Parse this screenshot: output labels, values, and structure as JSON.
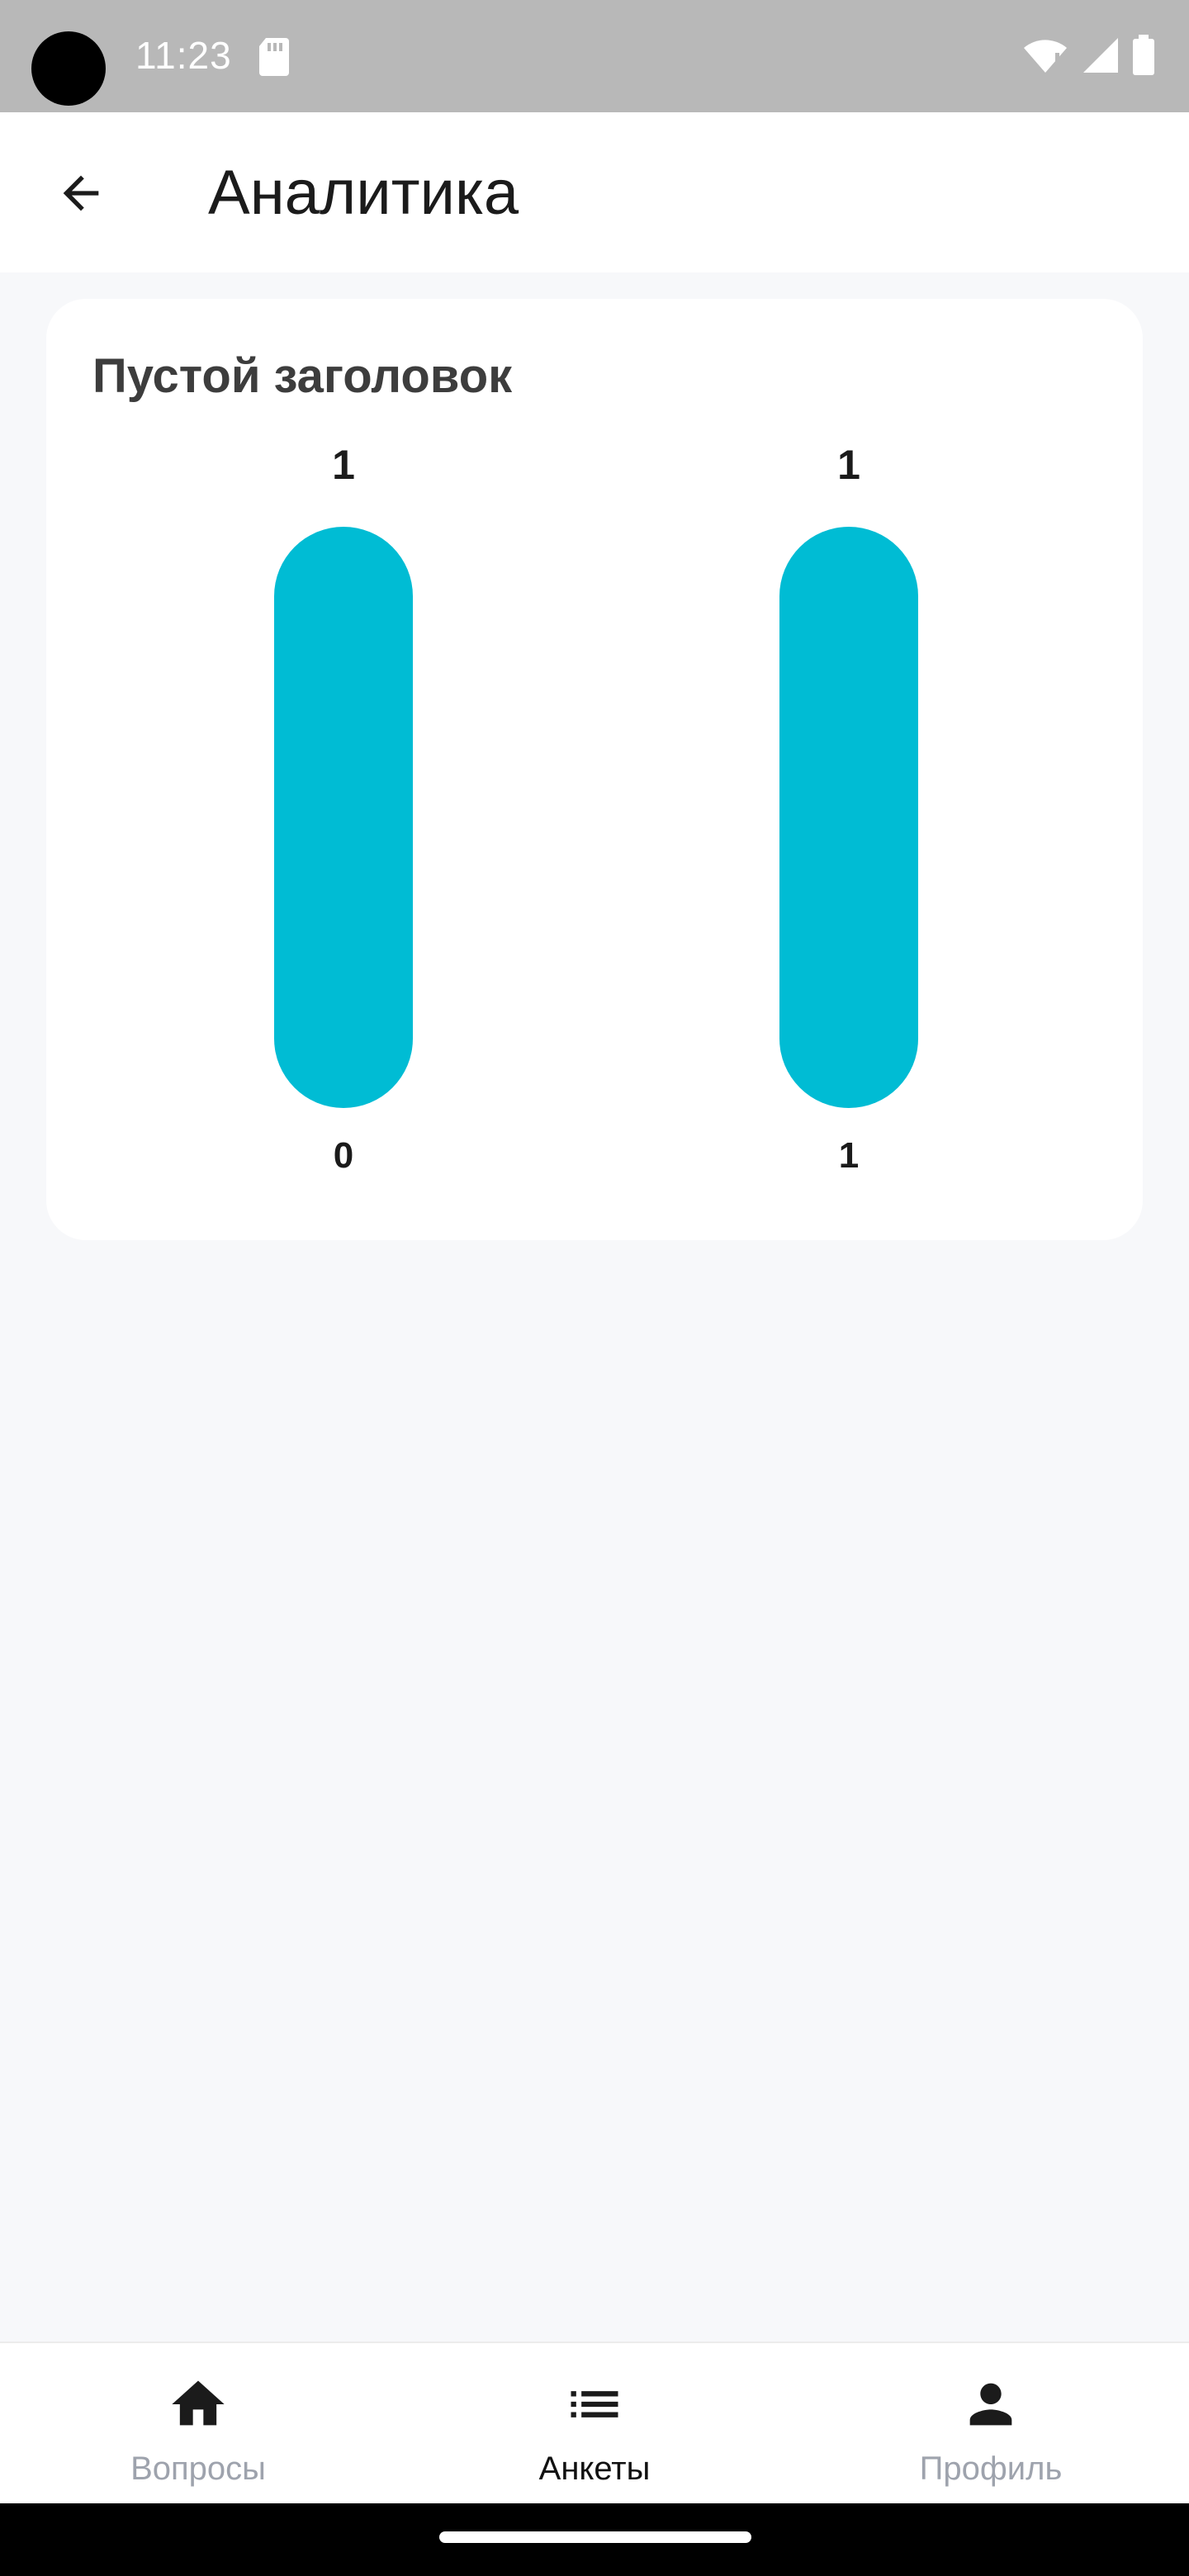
{
  "status_bar": {
    "time": "11:23"
  },
  "app_bar": {
    "title": "Аналитика"
  },
  "card": {
    "title": "Пустой заголовок"
  },
  "chart_data": {
    "type": "bar",
    "title": "Пустой заголовок",
    "bar_color": "#00bcd4",
    "columns": [
      {
        "top_label": "1",
        "bottom_label": "0",
        "value": 1
      },
      {
        "top_label": "1",
        "bottom_label": "1",
        "value": 1
      }
    ]
  },
  "bottom_nav": {
    "items": [
      {
        "label": "Вопросы",
        "icon": "home-icon",
        "active": false
      },
      {
        "label": "Анкеты",
        "icon": "list-icon",
        "active": true
      },
      {
        "label": "Профиль",
        "icon": "person-icon",
        "active": false
      }
    ]
  },
  "colors": {
    "accent": "#00bcd4",
    "nav_inactive": "#9ea3ad",
    "background": "#f7f8fa"
  }
}
